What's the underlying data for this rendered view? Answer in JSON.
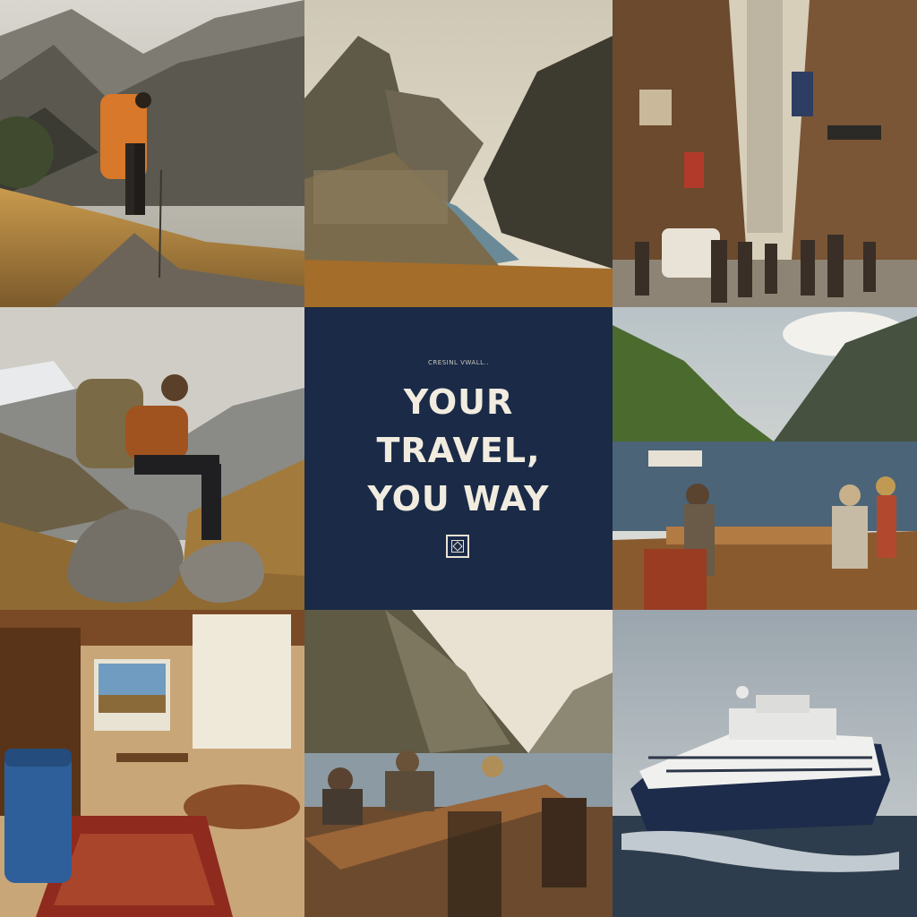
{
  "collage": {
    "headline_lines": [
      "YOUR",
      "TRAVEL,",
      "YOU WAY"
    ],
    "kicker": "CRESINL VWALL..",
    "colors": {
      "center_panel": "#1a2a47",
      "headline_text": "#f1ecdf"
    },
    "tiles": [
      {
        "id": "hiker-mountain-trail",
        "alt": "Hiker with orange backpack on mountain trail"
      },
      {
        "id": "machu-picchu-river",
        "alt": "Ancient ruins above river canyon"
      },
      {
        "id": "city-street",
        "alt": "Busy old city street with signs and van"
      },
      {
        "id": "backpacker-on-rock",
        "alt": "Backpacker sitting on rock overlooking mountains"
      },
      {
        "id": "lakeside-dining",
        "alt": "People dining on waterfront deck beside lake"
      },
      {
        "id": "hotel-room",
        "alt": "Rustic hotel room with suitcase and rug"
      },
      {
        "id": "fjord-table",
        "alt": "Group at table by fjord"
      },
      {
        "id": "cruise-ship",
        "alt": "Cruise ship sailing at sea"
      }
    ]
  }
}
